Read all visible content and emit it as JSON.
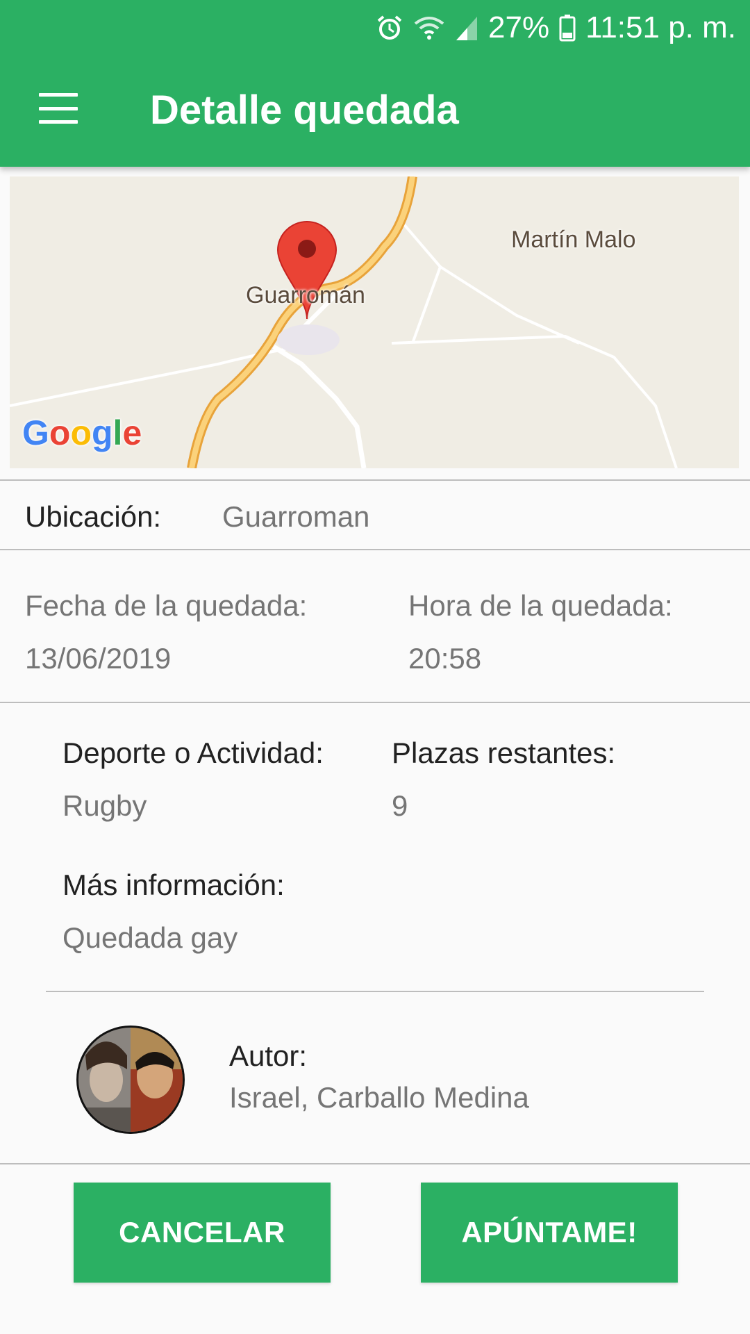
{
  "status_bar": {
    "battery": "27%",
    "time": "11:51 p. m."
  },
  "app_bar": {
    "title": "Detalle quedada"
  },
  "map": {
    "place_label": "Guarromán",
    "nearby_label": "Martín Malo",
    "attribution": "Google",
    "marker_color": "#ea4335"
  },
  "location": {
    "label": "Ubicación:",
    "value": "Guarroman"
  },
  "date": {
    "label": "Fecha de la quedada:",
    "value": "13/06/2019"
  },
  "time": {
    "label": "Hora de la quedada:",
    "value": "20:58"
  },
  "sport": {
    "label": "Deporte o Actividad:",
    "value": "Rugby"
  },
  "spots": {
    "label": "Plazas restantes:",
    "value": "9"
  },
  "info": {
    "label": "Más información:",
    "value": "Quedada gay"
  },
  "author": {
    "label": "Autor:",
    "value": "Israel, Carballo Medina"
  },
  "buttons": {
    "cancel": "CANCELAR",
    "join": "APÚNTAME!"
  },
  "colors": {
    "primary": "#2bb063",
    "label_text": "#212121",
    "value_text": "#757575"
  }
}
